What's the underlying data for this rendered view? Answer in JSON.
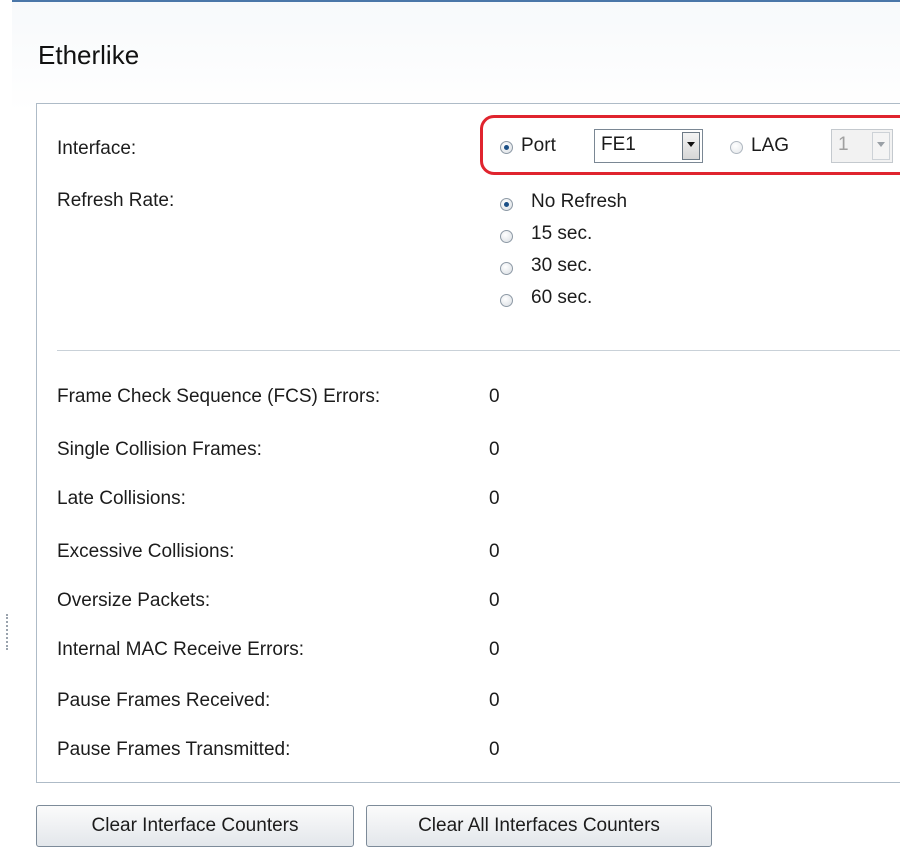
{
  "page": {
    "title": "Etherlike"
  },
  "interface": {
    "label": "Interface:",
    "port_option": "Port",
    "port_selected": "FE1",
    "lag_option": "LAG",
    "lag_selected": "1",
    "selected": "Port"
  },
  "refresh_rate": {
    "label": "Refresh Rate:",
    "options": [
      "No Refresh",
      "15 sec.",
      "30 sec.",
      "60 sec."
    ],
    "selected": "No Refresh"
  },
  "counters": [
    {
      "label": "Frame Check Sequence (FCS) Errors:",
      "value": "0"
    },
    {
      "label": "Single Collision Frames:",
      "value": "0"
    },
    {
      "label": "Late Collisions:",
      "value": "0"
    },
    {
      "label": "Excessive Collisions:",
      "value": "0"
    },
    {
      "label": "Oversize Packets:",
      "value": "0"
    },
    {
      "label": "Internal MAC Receive Errors:",
      "value": "0"
    },
    {
      "label": "Pause Frames Received:",
      "value": "0"
    },
    {
      "label": "Pause Frames Transmitted:",
      "value": "0"
    }
  ],
  "buttons": {
    "clear_interface": "Clear Interface Counters",
    "clear_all": "Clear All Interfaces Counters"
  },
  "colors": {
    "highlight": "#e0242e",
    "accent": "#1b4f86"
  }
}
